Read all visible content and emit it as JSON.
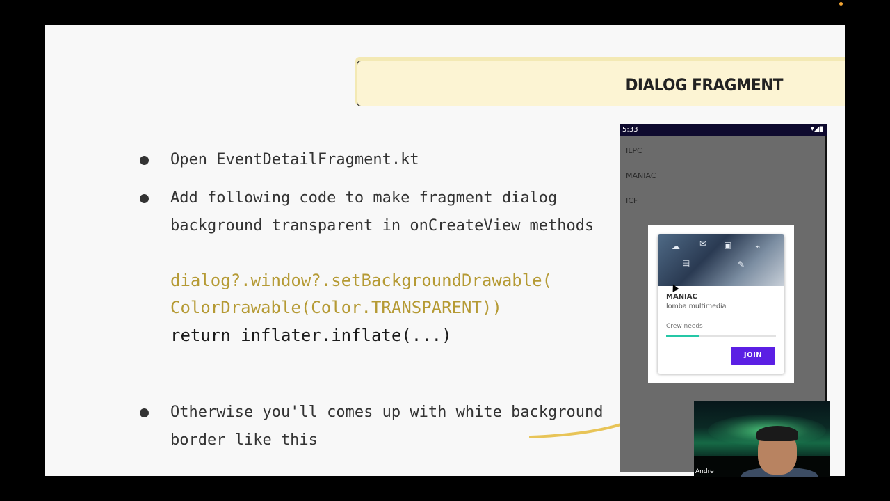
{
  "slide": {
    "title": "DIALOG FRAGMENT",
    "bullets": [
      "Open EventDetailFragment.kt",
      "Add following code to make fragment dialog",
      "background transparent in onCreateView methods",
      "Otherwise you'll comes up with white background",
      "border like this"
    ],
    "code": {
      "line1": "dialog?.window?.setBackgroundDrawable(",
      "line2": "ColorDrawable(Color.TRANSPARENT))",
      "line3": "return inflater.inflate(...)"
    }
  },
  "phone": {
    "status_time": "5:33",
    "status_icons": "▾◢▮",
    "list_items": [
      "ILPC",
      "MANIAC",
      "ICF"
    ],
    "card": {
      "title": "MANIAC",
      "subtitle": "lomba multimedia",
      "progress_label": "Crew needs",
      "progress_fraction": 0.3,
      "button_label": "JOIN"
    }
  },
  "webcam": {
    "name": "Andre"
  },
  "colors": {
    "title_bg": "#fcf4d3",
    "code_gold": "#b59a34",
    "join_button": "#5b1fe4",
    "progress_fill": "#25c7a6",
    "arrow": "#e8c457"
  }
}
